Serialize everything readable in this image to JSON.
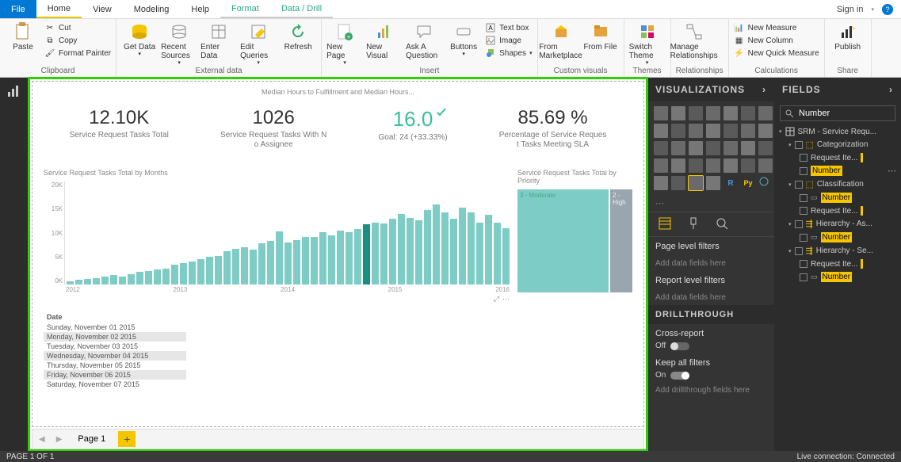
{
  "menu": {
    "file": "File",
    "home": "Home",
    "view": "View",
    "modeling": "Modeling",
    "help": "Help",
    "format": "Format",
    "datadrill": "Data / Drill",
    "signin": "Sign in"
  },
  "ribbon_groups": {
    "clipboard": "Clipboard",
    "external": "External data",
    "insert": "Insert",
    "custom": "Custom visuals",
    "themes": "Themes",
    "rel": "Relationships",
    "calc": "Calculations",
    "share": "Share"
  },
  "ribbon": {
    "paste": "Paste",
    "cut": "Cut",
    "copy": "Copy",
    "fmt": "Format Painter",
    "getdata": "Get Data",
    "recent": "Recent Sources",
    "enter": "Enter Data",
    "edit": "Edit Queries",
    "refresh": "Refresh",
    "newpage": "New Page",
    "newvis": "New Visual",
    "ask": "Ask A Question",
    "buttons": "Buttons",
    "textbox": "Text box",
    "image": "Image",
    "shapes": "Shapes",
    "market": "From Marketplace",
    "fromfile": "From File",
    "switch": "Switch Theme",
    "manage": "Manage Relationships",
    "newmeas": "New Measure",
    "newcol": "New Column",
    "quickm": "New Quick Measure",
    "publish": "Publish"
  },
  "report_title": "Median Hours to Fulfillment and Median Hours...",
  "kpis": [
    {
      "val": "12.10K",
      "label": "Service Request Tasks Total"
    },
    {
      "val": "1026",
      "label": "Service Request Tasks With No Assignee"
    },
    {
      "val": "16.0",
      "label": "Goal: 24 (+33.33%)",
      "green": true
    },
    {
      "val": "85.69 %",
      "label": "Percentage of Service Request Tasks Meeting SLA"
    }
  ],
  "chart_data": {
    "type": "bar",
    "title": "Service Request Tasks Total by Months",
    "ylabel": "",
    "ylim": [
      0,
      20000
    ],
    "yticks": [
      "20K",
      "15K",
      "10K",
      "5K",
      "0K"
    ],
    "categories": [
      "2012",
      "2013",
      "2014",
      "2015",
      "2016"
    ],
    "values": [
      600,
      900,
      1100,
      1300,
      1600,
      1900,
      1500,
      2000,
      2400,
      2600,
      2900,
      3100,
      3800,
      4100,
      4400,
      5000,
      5400,
      5600,
      6500,
      7000,
      7200,
      6800,
      8000,
      8400,
      10300,
      8200,
      8600,
      9200,
      9200,
      10100,
      9600,
      10400,
      10200,
      10800,
      11700,
      12000,
      11900,
      12800,
      13700,
      13000,
      12500,
      14500,
      15500,
      14000,
      12800,
      15000,
      14000,
      12000,
      13500,
      12000,
      11000
    ],
    "highlight_index": 34,
    "treemap": {
      "title": "Service Request Tasks Total by Priority",
      "items": [
        {
          "label": "3 - Moderate",
          "w": 5
        },
        {
          "label": "2 - High",
          "w": 1
        }
      ]
    }
  },
  "dates": {
    "header": "Date",
    "rows": [
      "Sunday, November 01 2015",
      "Monday, November 02 2015",
      "Tuesday, November 03 2015",
      "Wednesday, November 04 2015",
      "Thursday, November 05 2015",
      "Friday, November 06 2015",
      "Saturday, November 07 2015"
    ]
  },
  "pager": {
    "page": "Page 1"
  },
  "viz": {
    "title": "VISUALIZATIONS",
    "page_filters": "Page level filters",
    "add": "Add data fields here",
    "report_filters": "Report level filters",
    "drill": "DRILLTHROUGH",
    "cross": "Cross-report",
    "off": "Off",
    "keep": "Keep all filters",
    "on": "On",
    "adddrill": "Add drillthrough fields here"
  },
  "fields": {
    "title": "FIELDS",
    "search": "Number",
    "table": "SRM - Service Requ...",
    "rows": [
      {
        "ind": 1,
        "icon": "folder",
        "label": "Categorization"
      },
      {
        "ind": 2,
        "label": "Request Ite...",
        "gold": true
      },
      {
        "ind": 2,
        "label": "Number",
        "hl": true,
        "dots": true,
        "cursor": true
      },
      {
        "ind": 1,
        "icon": "folder",
        "label": "Classification"
      },
      {
        "ind": 2,
        "label": "Number",
        "hl": true,
        "box": true
      },
      {
        "ind": 2,
        "label": "Request Ite...",
        "gold": true
      },
      {
        "ind": 1,
        "icon": "hier",
        "label": "Hierarchy - As..."
      },
      {
        "ind": 2,
        "label": "Number",
        "hl": true,
        "box": true
      },
      {
        "ind": 1,
        "icon": "hier",
        "label": "Hierarchy - Se..."
      },
      {
        "ind": 2,
        "label": "Request Ite...",
        "gold": true
      },
      {
        "ind": 2,
        "label": "Number",
        "hl": true,
        "box": true
      }
    ]
  },
  "status": {
    "left": "PAGE 1 OF 1",
    "right": "Live connection: Connected"
  }
}
